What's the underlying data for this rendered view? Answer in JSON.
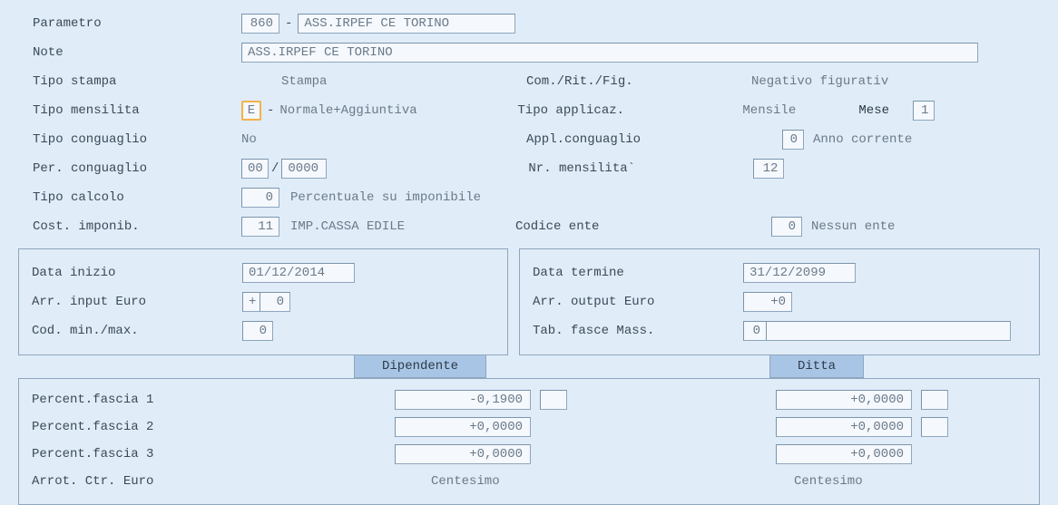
{
  "labels": {
    "parametro": "Parametro",
    "note": "Note",
    "tipo_stampa": "Tipo stampa",
    "com_rit_fig": "Com./Rit./Fig.",
    "tipo_mensilita": "Tipo mensilita",
    "tipo_applicaz": "Tipo applicaz.",
    "mese": "Mese",
    "tipo_conguaglio": "Tipo conguaglio",
    "appl_conguaglio": "Appl.conguaglio",
    "per_conguaglio": "Per. conguaglio",
    "nr_mensilita": "Nr. mensilita`",
    "tipo_calcolo": "Tipo calcolo",
    "cost_imponib": "Cost. imponib.",
    "codice_ente": "Codice ente",
    "data_inizio": "Data inizio",
    "arr_input_euro": "Arr. input Euro",
    "cod_min_max": "Cod. min./max.",
    "data_termine": "Data termine",
    "arr_output_euro": "Arr. output Euro",
    "tab_fasce_mass": "Tab. fasce Mass.",
    "percent_fascia_1": "Percent.fascia 1",
    "percent_fascia_2": "Percent.fascia 2",
    "percent_fascia_3": "Percent.fascia 3",
    "arrot_ctr_euro": "Arrot. Ctr. Euro"
  },
  "values": {
    "parametro_code": "860",
    "parametro_desc": "ASS.IRPEF CE TORINO",
    "note": "ASS.IRPEF CE TORINO",
    "tipo_stampa": "Stampa",
    "com_rit_fig": "Negativo figurativ",
    "tipo_mensilita_code": "E",
    "tipo_mensilita_desc": "Normale+Aggiuntiva",
    "tipo_applicaz": "Mensile",
    "mese": "1",
    "tipo_conguaglio": "No",
    "appl_conguaglio_code": "0",
    "appl_conguaglio_desc": "Anno corrente",
    "per_conguaglio_mm": "00",
    "per_conguaglio_yyyy": "0000",
    "nr_mensilita": "12",
    "tipo_calcolo_code": "0",
    "tipo_calcolo_desc": "Percentuale su imponibile",
    "cost_imponib_code": "11",
    "cost_imponib_desc": "IMP.CASSA EDILE",
    "codice_ente_code": "0",
    "codice_ente_desc": "Nessun ente",
    "data_inizio": "01/12/2014",
    "arr_input_sign": "+",
    "arr_input_val": "0",
    "cod_min_max": "0",
    "data_termine": "31/12/2099",
    "arr_output": "+0",
    "tab_fasce_mass": "0",
    "tab_fasce_mass_desc": "",
    "centesimo": "Centesimo"
  },
  "tabs": {
    "dipendente": "Dipendente",
    "ditta": "Ditta"
  },
  "fasce": {
    "dip1": "-0,1900",
    "dip2": "+0,0000",
    "dip3": "+0,0000",
    "dit1": "+0,0000",
    "dit2": "+0,0000",
    "dit3": "+0,0000"
  }
}
